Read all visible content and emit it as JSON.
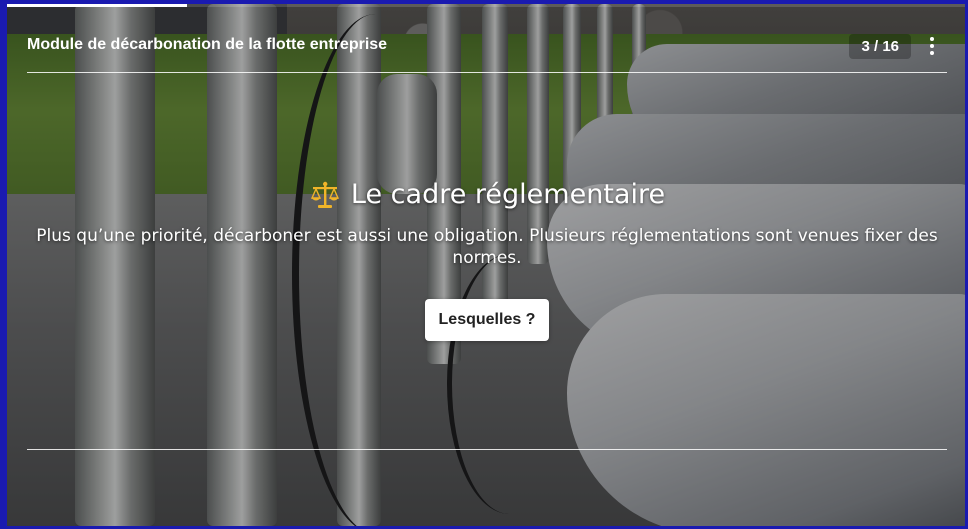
{
  "header": {
    "module_title": "Module de décarbonation de la flotte entreprise",
    "slide_counter": "3 / 16",
    "menu_icon": "kebab-menu-icon"
  },
  "progress": {
    "fraction": 0.1875
  },
  "slide": {
    "icon": "balance-scale-icon",
    "headline": "Le cadre réglementaire",
    "body": "Plus qu’une priorité, décarboner est aussi une obligation. Plusieurs réglementations sont venues fixer des normes.",
    "cta_label": "Lesquelles ?"
  },
  "colors": {
    "page_border": "#1a1ab0",
    "text": "#ffffff",
    "button_bg": "#ffffff",
    "icon_gold": "#f0b429"
  }
}
